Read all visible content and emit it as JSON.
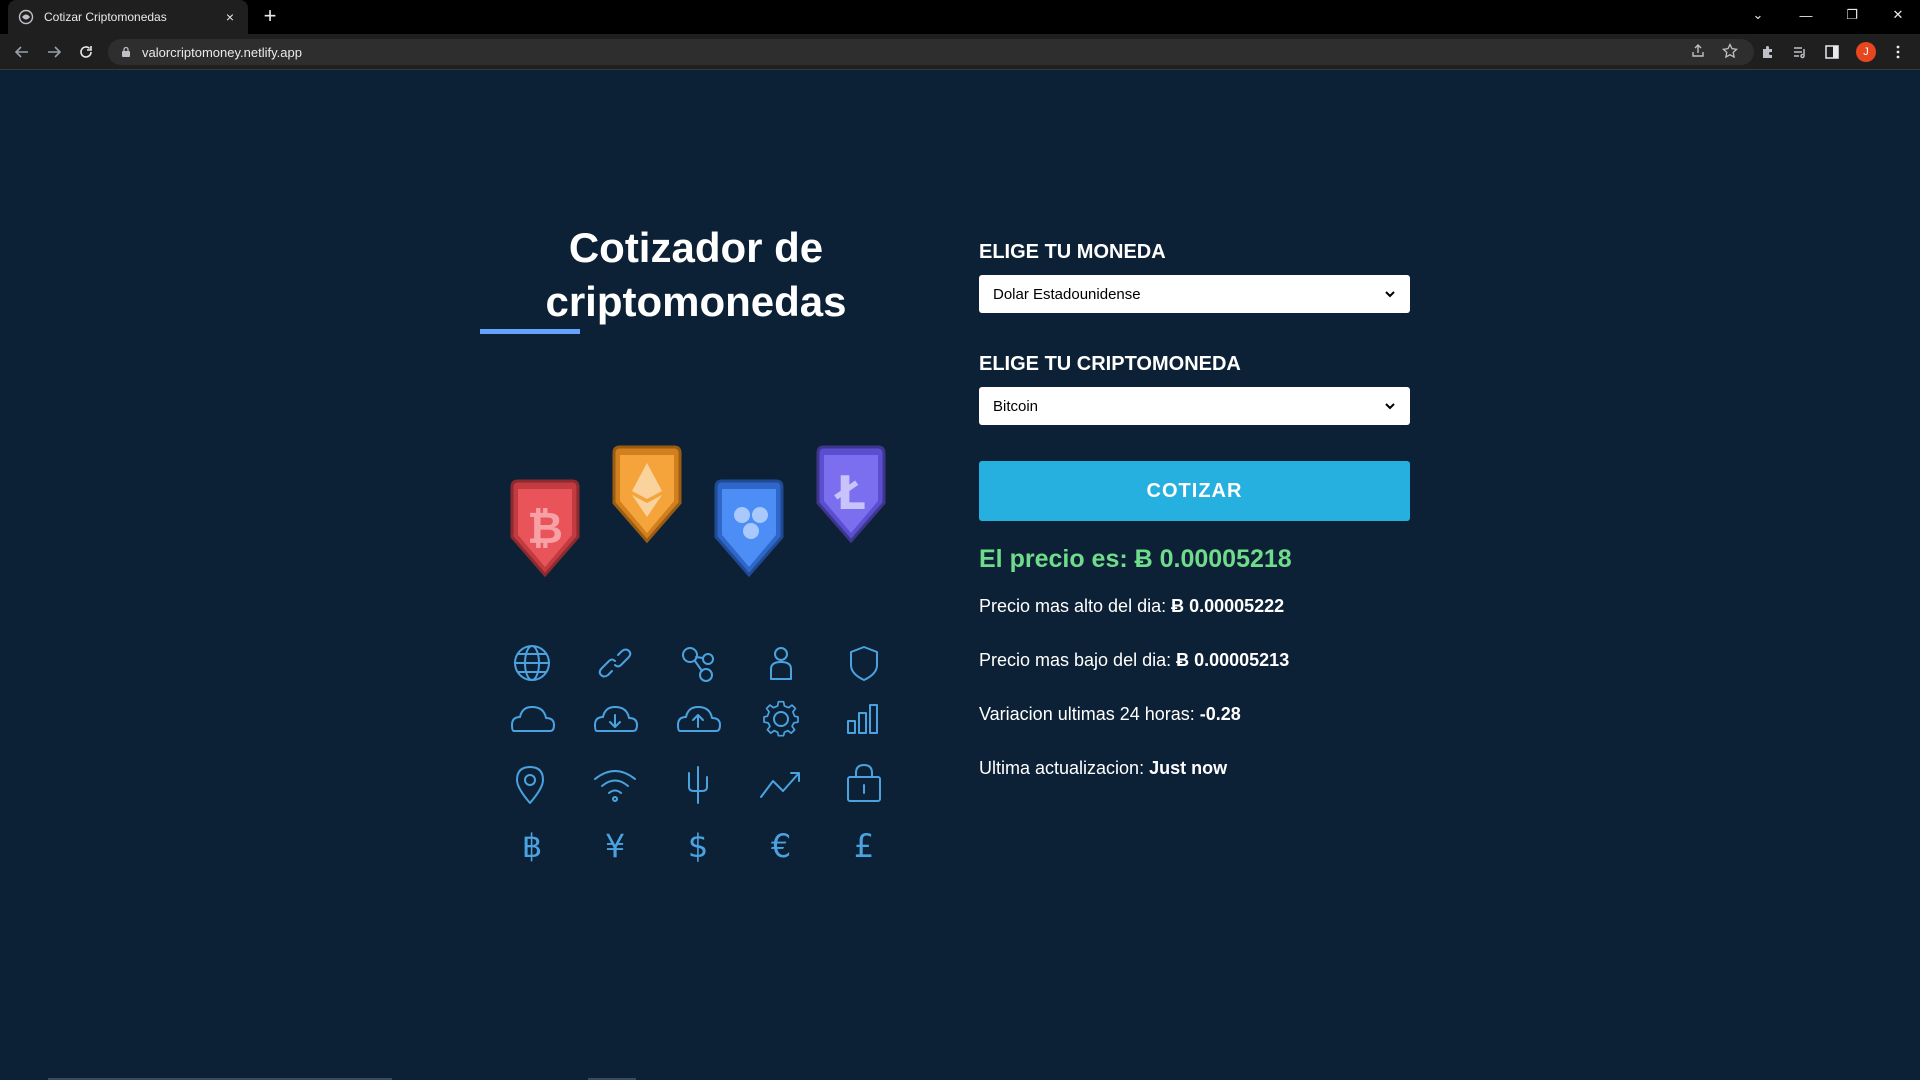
{
  "browser": {
    "tab_title": "Cotizar Criptomonedas",
    "tab_close": "×",
    "new_tab": "+",
    "url": "valorcriptomoney.netlify.app",
    "profile_initial": "J",
    "window_controls": [
      "⌄",
      "—",
      "❐",
      "✕"
    ]
  },
  "header": {
    "title": "Cotizador de criptomonedas"
  },
  "illustration": {
    "badges": [
      {
        "icon": "bitcoin-icon",
        "color": "#e9545a"
      },
      {
        "icon": "ethereum-icon",
        "color": "#f4a43a"
      },
      {
        "icon": "ripple-icon",
        "color": "#4c8df6"
      },
      {
        "icon": "litecoin-icon",
        "color": "#7b6ff0"
      }
    ],
    "icon_color": "#4aa3e0"
  },
  "form": {
    "currency_label": "Elige tu moneda",
    "currency_value": "Dolar Estadounidense",
    "crypto_label": "Elige tu Criptomoneda",
    "crypto_value": "Bitcoin",
    "submit_label": "Cotizar"
  },
  "result": {
    "price_label": "El precio es: ",
    "price_value": "Ƀ 0.00005218",
    "high_label": "Precio mas alto del dia: ",
    "high_value": "Ƀ 0.00005222",
    "low_label": "Precio mas bajo del dia: ",
    "low_value": "Ƀ 0.00005213",
    "change_label": "Variacion ultimas 24 horas: ",
    "change_value": "-0.28",
    "updated_label": "Ultima actualizacion: ",
    "updated_value": "Just now"
  },
  "colors": {
    "background": "#0d2136",
    "accent": "#26b0df",
    "price": "#6fdc8c",
    "underline": "#66a2fe"
  }
}
